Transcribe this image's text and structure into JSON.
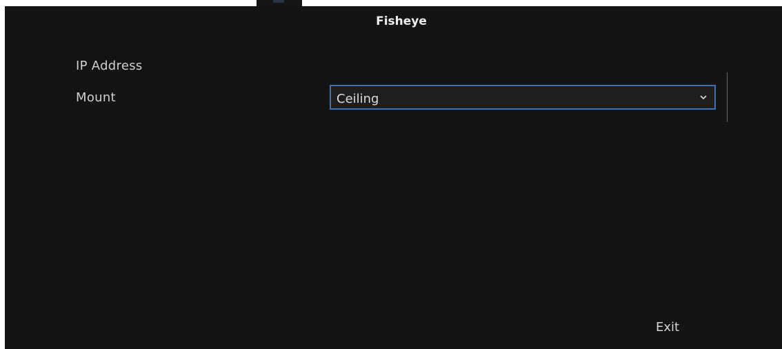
{
  "dialog": {
    "title": "Fisheye"
  },
  "fields": {
    "ip_address_label": "IP Address",
    "mount_label": "Mount",
    "mount_value": "Ceiling"
  },
  "footer": {
    "exit_label": "Exit"
  },
  "icons": {
    "dropdown": "chevron-down-icon"
  },
  "colors": {
    "background": "#141414",
    "accent": "#3f72b8",
    "text": "#d6d6d6"
  }
}
